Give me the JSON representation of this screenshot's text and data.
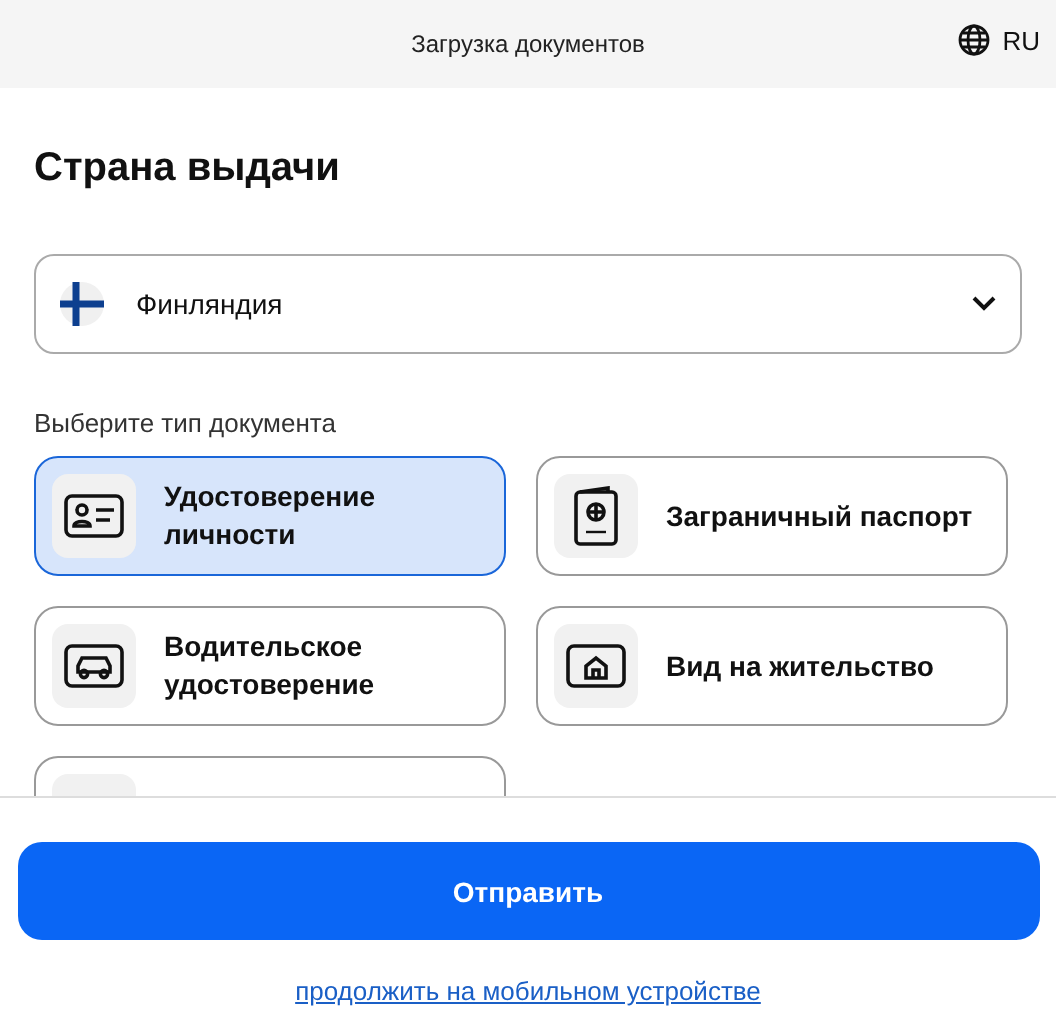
{
  "header": {
    "title": "Загрузка документов",
    "language": "RU"
  },
  "heading": "Страна выдачи",
  "country_select": {
    "value": "Финляндия",
    "kind": "finland"
  },
  "document_label": "Выберите тип документа",
  "documents": [
    {
      "kind": "id_card",
      "label": "Удостоверение личности",
      "selected": true
    },
    {
      "kind": "passport",
      "label": "Заграничный паспорт",
      "selected": false
    },
    {
      "kind": "driver_license",
      "label": "Водительское удостоверение",
      "selected": false
    },
    {
      "kind": "residence",
      "label": "Вид на жительство",
      "selected": false
    }
  ],
  "more_cards_below": true,
  "submit_button": "Отправить",
  "mobile_link": "продолжить на мобильном устройстве"
}
